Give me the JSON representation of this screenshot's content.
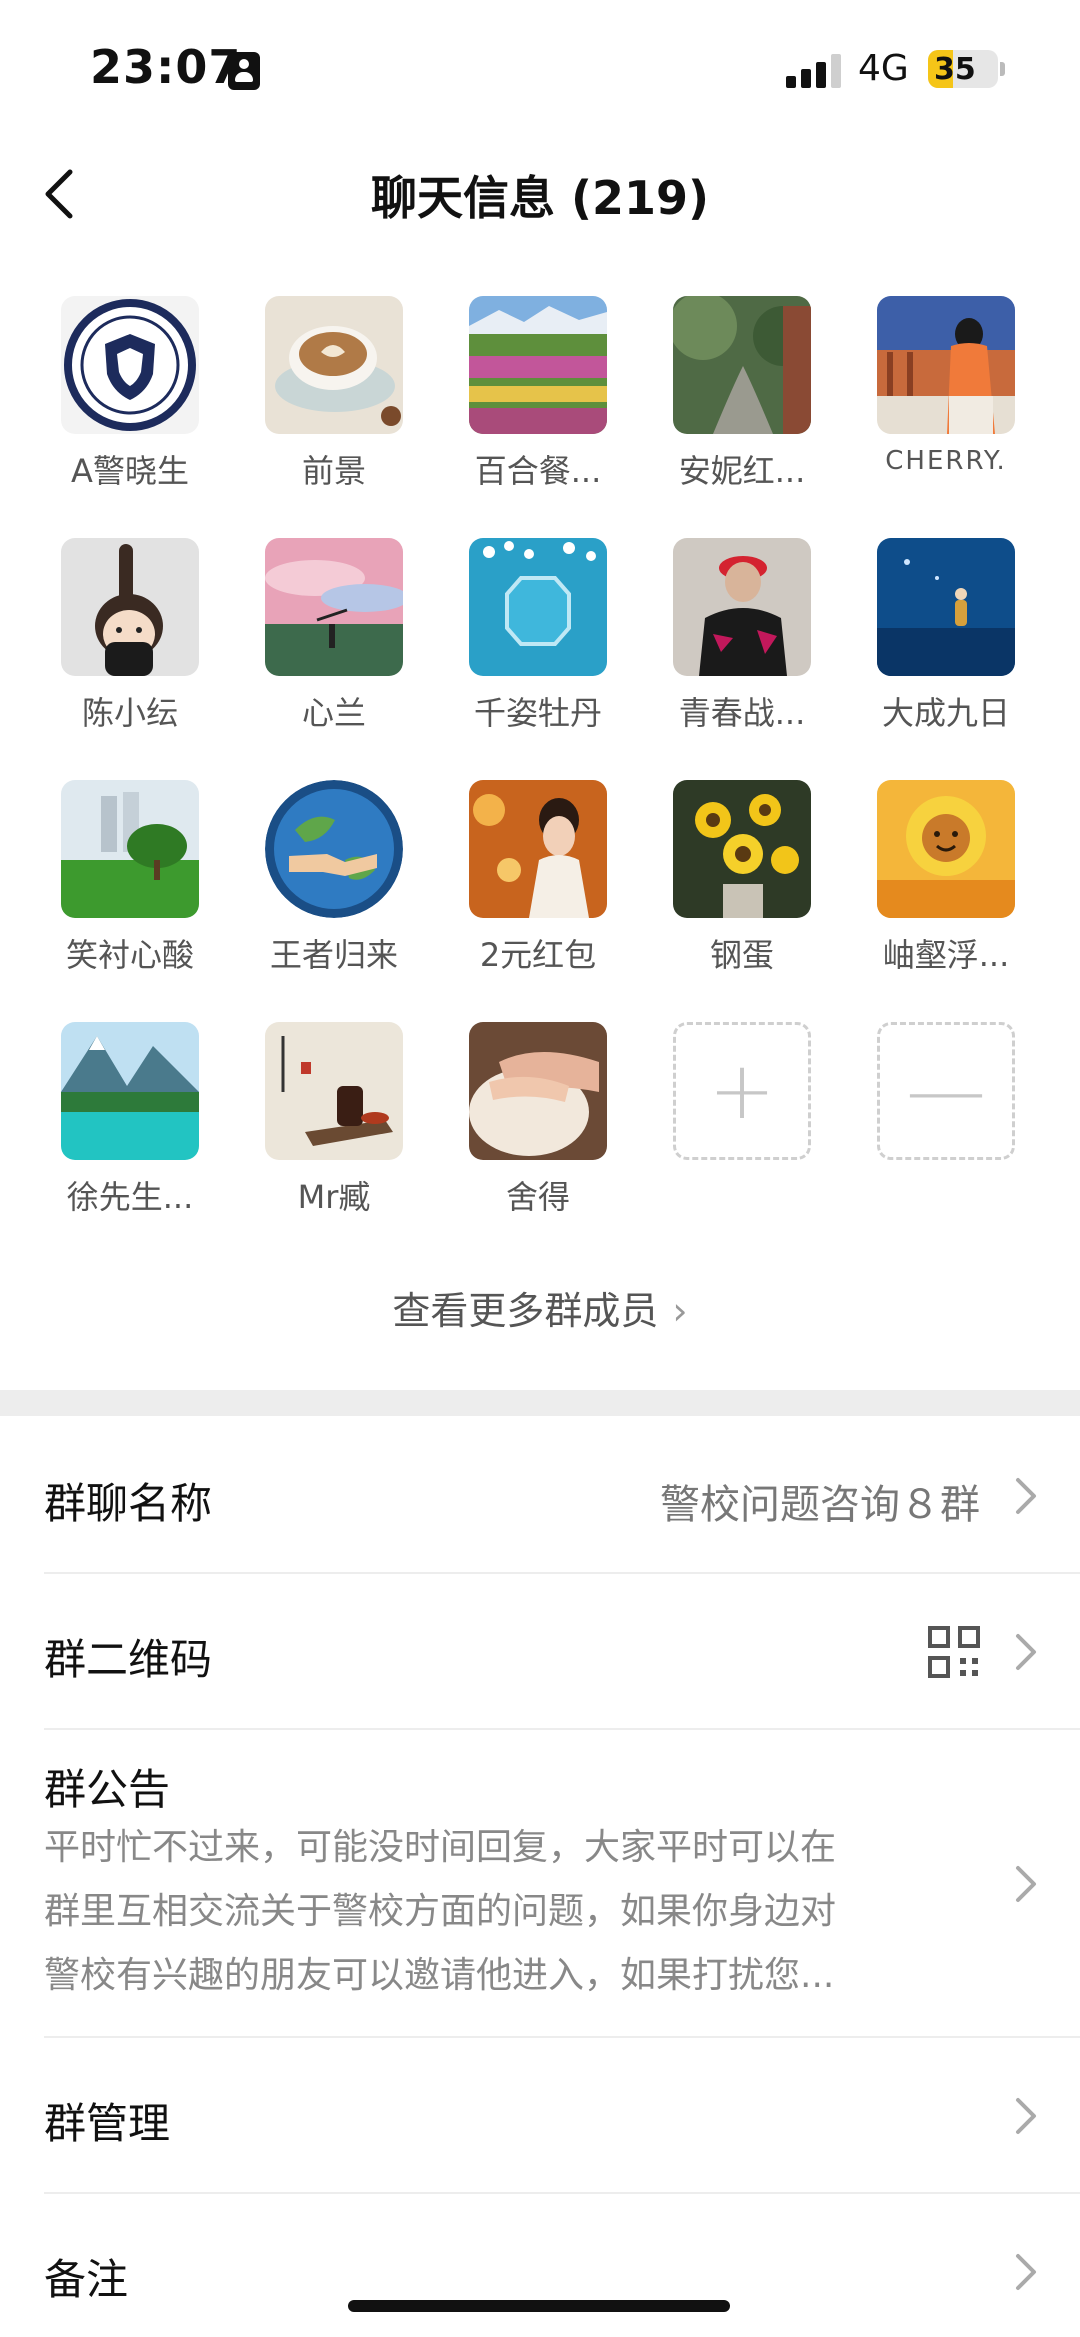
{
  "status": {
    "time": "23:07",
    "network": "4G",
    "battery": "35",
    "battery_level": 0.35
  },
  "nav": {
    "title": "聊天信息 (219)"
  },
  "members": [
    {
      "name": "A警晓生",
      "icon": "police-badge"
    },
    {
      "name": "前景",
      "icon": "coffee-cup"
    },
    {
      "name": "百合餐...",
      "icon": "flower-field"
    },
    {
      "name": "安妮红...",
      "icon": "garden-path"
    },
    {
      "name": "CHERRY.",
      "icon": "girl-balcony"
    },
    {
      "name": "陈小纭",
      "icon": "cartoon-girl"
    },
    {
      "name": "心兰",
      "icon": "sky-field"
    },
    {
      "name": "千姿牡丹",
      "icon": "blue-window"
    },
    {
      "name": "青春战...",
      "icon": "man-red-cap"
    },
    {
      "name": "大成九日",
      "icon": "night-sea"
    },
    {
      "name": "笑衬心酸",
      "icon": "tree-lawn"
    },
    {
      "name": "王者归来",
      "icon": "globe-handshake"
    },
    {
      "name": "2元红包",
      "icon": "woman-candles"
    },
    {
      "name": "钢蛋",
      "icon": "sunflowers"
    },
    {
      "name": "岫壑浮...",
      "icon": "sunflower-face"
    },
    {
      "name": "徐先生...",
      "icon": "mountain-lake"
    },
    {
      "name": "Mr臧",
      "icon": "tea-set"
    },
    {
      "name": "舍得",
      "icon": "baby-hand"
    }
  ],
  "actions": {
    "add": "+",
    "remove": "—"
  },
  "more_members": "查看更多群成员",
  "settings": {
    "group_name": {
      "label": "群聊名称",
      "value": "警校问题咨询８群"
    },
    "qr_code": {
      "label": "群二维码"
    },
    "notice": {
      "label": "群公告",
      "lines": [
        "平时忙不过来，可能没时间回复，大家平时可以在",
        "群里互相交流关于警校方面的问题，如果你身边对",
        "警校有兴趣的朋友可以邀请他进入，如果打扰您..."
      ]
    },
    "manage": {
      "label": "群管理"
    },
    "remark": {
      "label": "备注"
    }
  }
}
